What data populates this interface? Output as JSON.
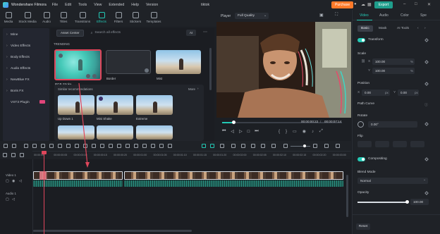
{
  "titlebar": {
    "app_name": "Wondershare Filmora",
    "menus": [
      "File",
      "Edit",
      "Tools",
      "View",
      "Extended",
      "Help",
      "Version"
    ],
    "project_name": "tiktok",
    "purchase_label": "Purchase",
    "export_label": "Export"
  },
  "toolbar": {
    "items": [
      {
        "label": "Media",
        "icon": "media-icon"
      },
      {
        "label": "Stock Media",
        "icon": "stock-media-icon"
      },
      {
        "label": "Audio",
        "icon": "audio-icon"
      },
      {
        "label": "Titles",
        "icon": "titles-icon"
      },
      {
        "label": "Transitions",
        "icon": "transitions-icon"
      },
      {
        "label": "Effects",
        "icon": "effects-icon",
        "active": true
      },
      {
        "label": "Filters",
        "icon": "filters-icon"
      },
      {
        "label": "Stickers",
        "icon": "stickers-icon"
      },
      {
        "label": "Templates",
        "icon": "templates-icon"
      }
    ],
    "accent_color": "#23c9b5"
  },
  "sidebar": {
    "items": [
      {
        "label": "Mine"
      },
      {
        "label": "Video Effects"
      },
      {
        "label": "Body Effects"
      },
      {
        "label": "Audio Effects"
      },
      {
        "label": "NewBlue FX"
      },
      {
        "label": "Boris FX"
      },
      {
        "label": "VST3 Plugin",
        "badge": true
      }
    ]
  },
  "browser": {
    "asset_button": "Asset Center",
    "search_placeholder": "Search all effects",
    "ai_label": "AI",
    "trending_label": "TRENDING",
    "trending": [
      {
        "caption": "RGB Stroke",
        "selected": true
      },
      {
        "caption": "Border"
      },
      {
        "caption": "Mist"
      }
    ],
    "similar_label": "Similar recommendations",
    "more_label": "More",
    "similar": [
      {
        "caption": "Up Down 1"
      },
      {
        "caption": "Mini Shake"
      },
      {
        "caption": "Extreme"
      }
    ]
  },
  "player": {
    "label": "Player",
    "quality": "Full Quality",
    "time_current": "00:00:00:22",
    "time_total": "00:00:07:14"
  },
  "rightpanel": {
    "tabs": [
      "Video",
      "Audio",
      "Color",
      "Spe"
    ],
    "subtabs": [
      "Basic",
      "Mask",
      "AI Tools"
    ],
    "transform_label": "Transform",
    "scale_label": "Scale",
    "scale_x": "100.00",
    "scale_y": "100.00",
    "scale_unit": "%",
    "position_label": "Position",
    "pos_x": "0.00",
    "pos_y": "0.00",
    "pos_unit": "px",
    "path_curve_label": "Path Curve",
    "rotate_label": "Rotate",
    "rotate_value": "0.00°",
    "flip_label": "Flip",
    "compositing_label": "Compositing",
    "blend_label": "Blend Mode",
    "blend_value": "Normal",
    "opacity_label": "Opacity",
    "opacity_value": "100.00",
    "opacity_fraction": 1.0,
    "reset_label": "Reset"
  },
  "timeline": {
    "ruler": [
      "00:00:00",
      "00:00:00:05",
      "00:00:00:10",
      "00:00:00:15",
      "00:00:00:20",
      "00:00:01:00",
      "00:00:01:05",
      "00:00:01:10",
      "00:00:01:15",
      "00:00:01:20",
      "00:00:02:00",
      "00:00:02:05",
      "00:00:02:10",
      "00:00:02:15",
      "00:00:02:20",
      "00:00:03:00"
    ],
    "video_track": "Video 1",
    "audio_track": "Audio 1"
  }
}
